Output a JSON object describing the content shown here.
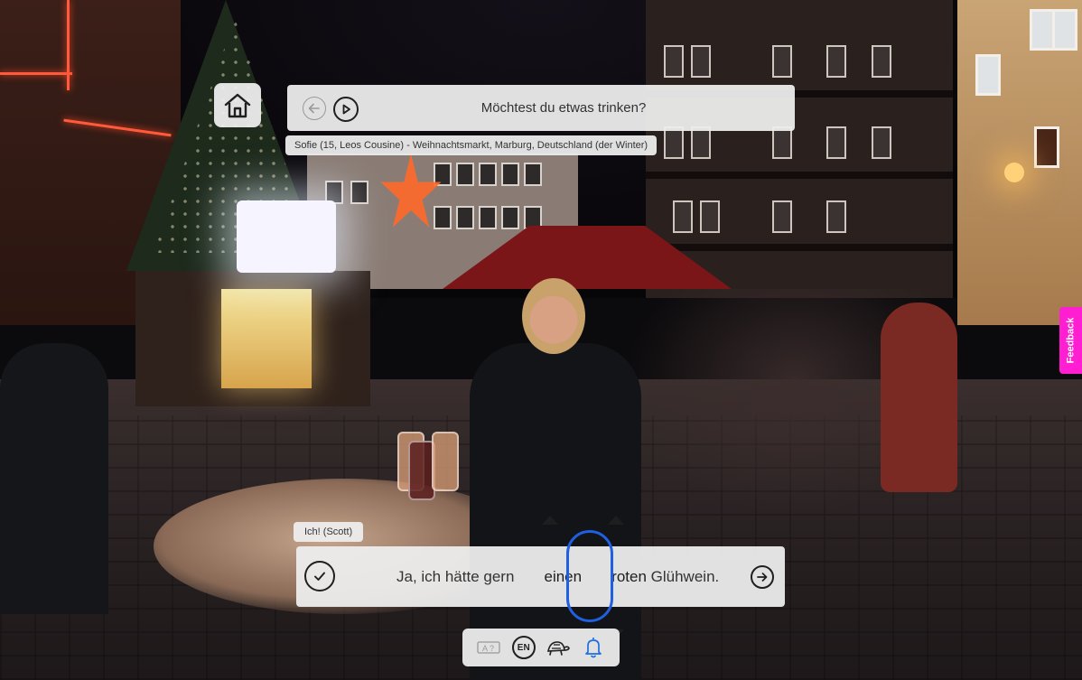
{
  "scene": {
    "description_icon": "christmas-market-360-photo"
  },
  "header": {
    "home_icon": "house-icon",
    "back_icon": "circle-arrow-left-icon",
    "play_icon": "circle-play-icon",
    "prompt_text": "Möchtest du etwas trinken?"
  },
  "speaker": {
    "label": "Sofie (15, Leos Cousine) - Weihnachtsmarkt, Marburg, Deutschland (der Winter)"
  },
  "answer": {
    "speaker_label": "Ich! (Scott)",
    "confirm_icon": "circle-check-icon",
    "text_before": "Ja, ich hätte gern ",
    "slot1_value": "einen",
    "slot2_value": "roten",
    "text_after": " Glühwein.",
    "next_icon": "circle-arrow-right-icon"
  },
  "toolbar": {
    "tools": [
      {
        "name": "translate-icon",
        "label": "A ?"
      },
      {
        "name": "language-en-icon",
        "label": "EN"
      },
      {
        "name": "turtle-slow-icon",
        "label": ""
      },
      {
        "name": "bell-icon",
        "label": ""
      }
    ]
  },
  "feedback": {
    "label": "Feedback",
    "color": "#ff1ed2"
  },
  "colors": {
    "focus": "#1f5fe0",
    "accent_bell": "#1f6fe0",
    "panel": "#eeeeee"
  }
}
